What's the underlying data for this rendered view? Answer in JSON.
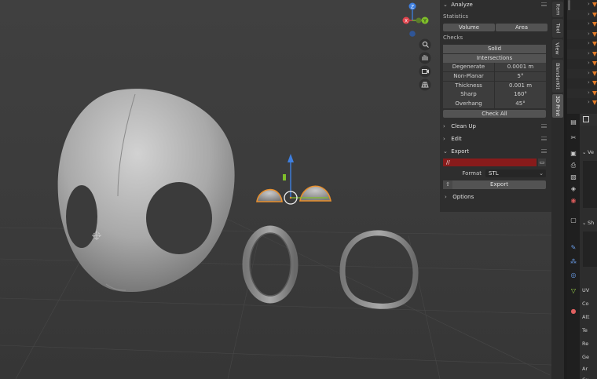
{
  "npanel": {
    "analyze": {
      "title": "Analyze",
      "statistics_label": "Statistics",
      "volume_btn": "Volume",
      "area_btn": "Area",
      "checks_label": "Checks",
      "solid_btn": "Solid",
      "intersections_btn": "Intersections",
      "rows": [
        {
          "label": "Degenerate",
          "value": "0.0001 m"
        },
        {
          "label": "Non-Planar",
          "value": "5°"
        },
        {
          "label": "Thickness",
          "value": "0.001 m"
        },
        {
          "label": "Sharp",
          "value": "160°"
        },
        {
          "label": "Overhang",
          "value": "45°"
        }
      ],
      "check_all_btn": "Check All"
    },
    "cleanup": {
      "title": "Clean Up"
    },
    "edit": {
      "title": "Edit"
    },
    "export": {
      "title": "Export",
      "path_value": "//",
      "format_label": "Format",
      "format_value": "STL",
      "export_btn": "Export",
      "options_label": "Options"
    }
  },
  "vtabs": [
    "Item",
    "Tool",
    "View",
    "BlenderKit",
    "3D Print"
  ],
  "vtab_active": "3D Print",
  "gizmo": {
    "x": "X",
    "y": "Y",
    "z": "Z"
  },
  "colors": {
    "axis_x": "#e0444d",
    "axis_y": "#7fbf2a",
    "axis_z": "#3e7fe0",
    "selection": "#e8902e",
    "export_path_bg": "#8b1a1a"
  },
  "properties_partial": [
    "Ve",
    "Sh",
    "UV",
    "Co",
    "Att",
    "Te",
    "Re",
    "Ge",
    "Ar",
    "Cu"
  ]
}
